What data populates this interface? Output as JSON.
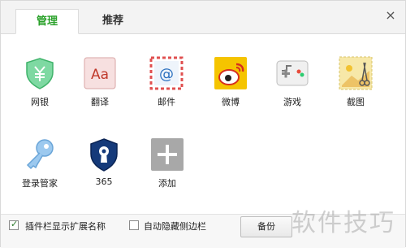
{
  "tabs": [
    {
      "label": "管理",
      "active": true
    },
    {
      "label": "推荐",
      "active": false
    }
  ],
  "close_glyph": "×",
  "items": [
    {
      "label": "网银",
      "icon": "shield-yen-icon"
    },
    {
      "label": "翻译",
      "icon": "translate-icon"
    },
    {
      "label": "邮件",
      "icon": "mail-icon"
    },
    {
      "label": "微博",
      "icon": "weibo-icon"
    },
    {
      "label": "游戏",
      "icon": "gamepad-icon"
    },
    {
      "label": "截图",
      "icon": "scissors-icon"
    },
    {
      "label": "登录管家",
      "icon": "key-icon"
    },
    {
      "label": "365",
      "icon": "keyhole-shield-icon"
    },
    {
      "label": "添加",
      "icon": "add-icon"
    }
  ],
  "footer": {
    "checkbox1": {
      "label": "插件栏显示扩展名称",
      "checked": true,
      "mark": "✓"
    },
    "checkbox2": {
      "label": "自动隐藏侧边栏",
      "checked": false
    },
    "backup_label": "备份"
  },
  "watermark": "软件技巧",
  "colors": {
    "accent": "#2aa12a"
  }
}
